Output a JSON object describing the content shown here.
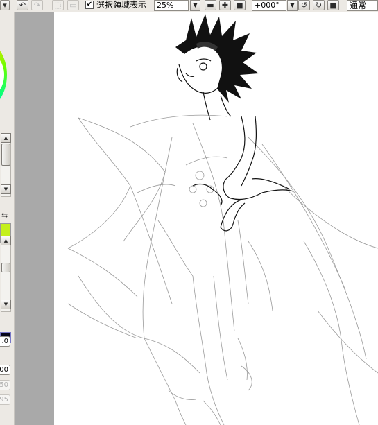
{
  "toolbar": {
    "show_selection_label": "選択領域表示",
    "show_selection_checked": true,
    "zoom_value": "25%",
    "rotation_value": "+000°",
    "blend_mode": "通常"
  },
  "left_panel": {
    "value_1": ".0",
    "value_2": "00",
    "value_3": "50",
    "value_4": "95"
  },
  "colors": {
    "foreground_color": "#c4f01c",
    "brush_color": "#06061a",
    "canvas_background": "#ffffff",
    "outside_canvas": "#a9a9a9"
  },
  "canvas": {
    "content": "line-art-drawing"
  }
}
